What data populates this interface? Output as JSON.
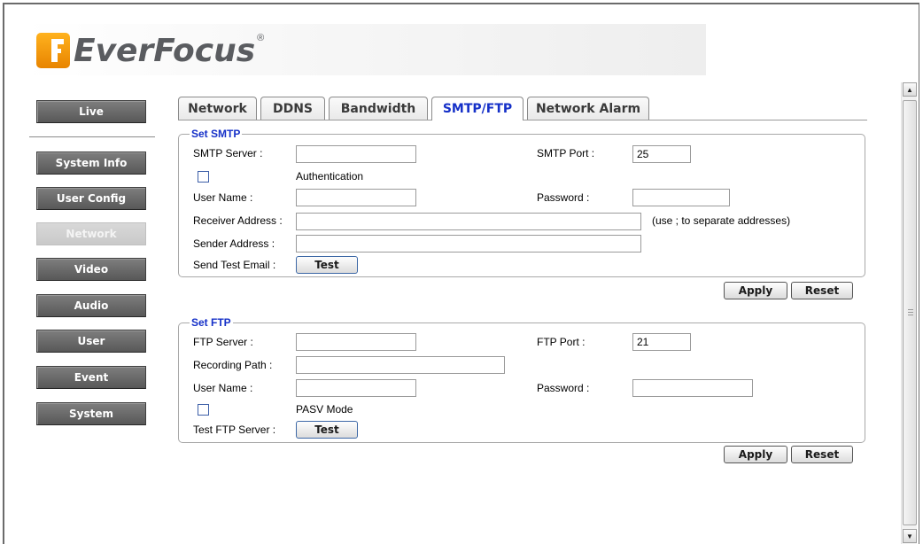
{
  "brand": {
    "name": "EverFocus",
    "registered": "®"
  },
  "sidebar": {
    "items": [
      {
        "label": "Live"
      },
      {
        "label": "System Info"
      },
      {
        "label": "User Config"
      },
      {
        "label": "Network",
        "active": true
      },
      {
        "label": "Video"
      },
      {
        "label": "Audio"
      },
      {
        "label": "User"
      },
      {
        "label": "Event"
      },
      {
        "label": "System"
      }
    ]
  },
  "tabs": [
    {
      "label": "Network"
    },
    {
      "label": "DDNS"
    },
    {
      "label": "Bandwidth"
    },
    {
      "label": "SMTP/FTP",
      "active": true
    },
    {
      "label": "Network Alarm"
    }
  ],
  "smtp": {
    "legend": "Set SMTP",
    "server_label": "SMTP Server :",
    "server_value": "",
    "port_label": "SMTP Port :",
    "port_value": "25",
    "auth_label": "Authentication",
    "auth_checked": false,
    "username_label": "User Name :",
    "username_value": "",
    "password_label": "Password :",
    "password_value": "",
    "receiver_label": "Receiver Address :",
    "receiver_value": "",
    "receiver_hint": "(use ; to separate addresses)",
    "sender_label": "Sender Address :",
    "sender_value": "",
    "test_label": "Send Test Email :",
    "test_button": "Test",
    "apply_button": "Apply",
    "reset_button": "Reset"
  },
  "ftp": {
    "legend": "Set FTP",
    "server_label": "FTP Server :",
    "server_value": "",
    "port_label": "FTP Port :",
    "port_value": "21",
    "path_label": "Recording Path :",
    "path_value": "",
    "username_label": "User Name :",
    "username_value": "",
    "password_label": "Password :",
    "password_value": "",
    "pasv_label": "PASV Mode",
    "pasv_checked": false,
    "test_label": "Test FTP Server :",
    "test_button": "Test",
    "apply_button": "Apply",
    "reset_button": "Reset"
  },
  "colors": {
    "accent": "#1530c8",
    "nav": "#666666",
    "nav_active": "#d0d0d0"
  }
}
